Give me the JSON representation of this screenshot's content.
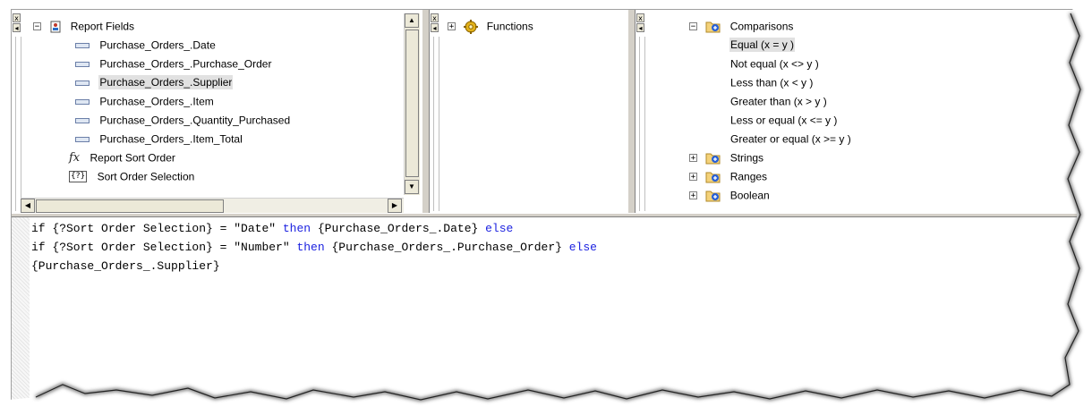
{
  "report_fields": {
    "root_label": "Report Fields",
    "items": [
      {
        "label": "Purchase_Orders_.Date",
        "icon": "field-icon",
        "selected": false
      },
      {
        "label": "Purchase_Orders_.Purchase_Order",
        "icon": "field-icon",
        "selected": false
      },
      {
        "label": "Purchase_Orders_.Supplier",
        "icon": "field-icon",
        "selected": true
      },
      {
        "label": "Purchase_Orders_.Item",
        "icon": "field-icon",
        "selected": false
      },
      {
        "label": "Purchase_Orders_.Quantity_Purchased",
        "icon": "field-icon",
        "selected": false
      },
      {
        "label": "Purchase_Orders_.Item_Total",
        "icon": "field-icon",
        "selected": false
      },
      {
        "label": "Report Sort Order",
        "icon": "formula-icon",
        "selected": false
      },
      {
        "label": "Sort Order Selection",
        "icon": "parameter-icon",
        "selected": false
      }
    ],
    "fx_glyph": "fx",
    "param_glyph": "{?}"
  },
  "functions": {
    "root_label": "Functions"
  },
  "operators": {
    "comparisons_label": "Comparisons",
    "comparisons_items": [
      "Equal (x = y )",
      "Not equal (x <> y )",
      "Less than (x < y )",
      "Greater than (x > y )",
      "Less or equal (x <= y )",
      "Greater or equal (x >= y )"
    ],
    "selected_index": 0,
    "groups": [
      "Strings",
      "Ranges",
      "Boolean"
    ]
  },
  "expander_glyphs": {
    "collapse": "−",
    "expand": "+"
  },
  "pin_glyphs": {
    "close": "x",
    "pin": "◂"
  },
  "scroll_glyphs": {
    "up": "▲",
    "down": "▼",
    "left": "◀",
    "right": "▶"
  },
  "editor": {
    "line1": {
      "a": "if {?Sort Order Selection} = \"Date\" ",
      "kw1": "then",
      "b": " {Purchase_Orders_.Date} ",
      "kw2": "else"
    },
    "line2": {
      "a": "if {?Sort Order Selection} = \"Number\" ",
      "kw1": "then",
      "b": " {Purchase_Orders_.Purchase_Order} ",
      "kw2": "else"
    },
    "line3": "{Purchase_Orders_.Supplier}"
  }
}
